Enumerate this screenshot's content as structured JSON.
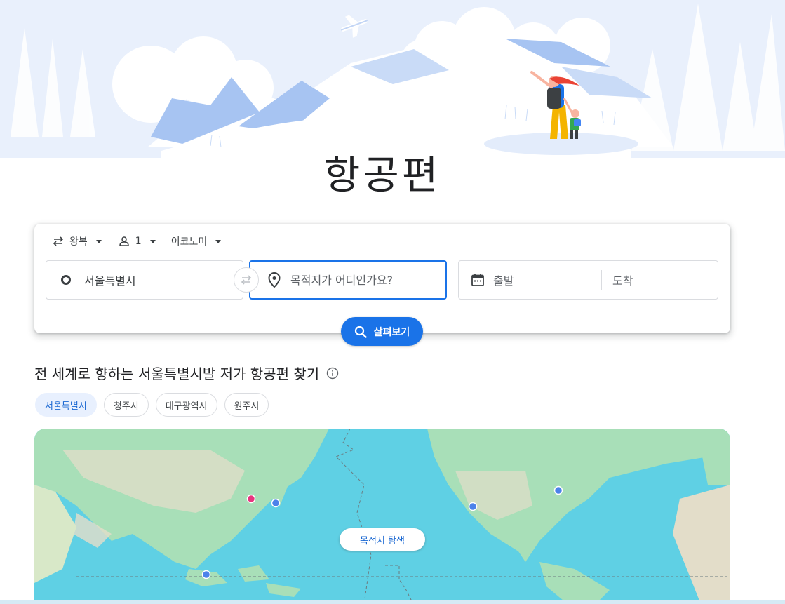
{
  "page": {
    "title": "항공편"
  },
  "search": {
    "trip_type": "왕복",
    "passengers": "1",
    "cabin_class": "이코노미",
    "origin": "서울특별시",
    "destination_placeholder": "목적지가 어디인가요?",
    "departure_placeholder": "출발",
    "return_placeholder": "도착",
    "explore_button": "살펴보기"
  },
  "explore": {
    "heading": "전 세계로 향하는 서울특별시발 저가 항공편 찾기",
    "chips": [
      {
        "label": "서울특별시",
        "selected": true
      },
      {
        "label": "청주시",
        "selected": false
      },
      {
        "label": "대구광역시",
        "selected": false
      },
      {
        "label": "원주시",
        "selected": false
      }
    ],
    "map_button": "목적지 탐색"
  },
  "colors": {
    "accent": "#1a73e8",
    "chip_selected_bg": "#e8f0fe",
    "origin_marker": "#e8347f",
    "destination_marker": "#4c82ea",
    "ocean": "#5fd0e4",
    "land": "#a8dfb8"
  },
  "icons": {
    "trip_type": "swap-arrows-icon",
    "passengers": "person-icon",
    "origin": "circle-icon",
    "destination": "location-pin-icon",
    "dates": "calendar-icon",
    "explore": "search-icon",
    "info": "info-icon"
  }
}
